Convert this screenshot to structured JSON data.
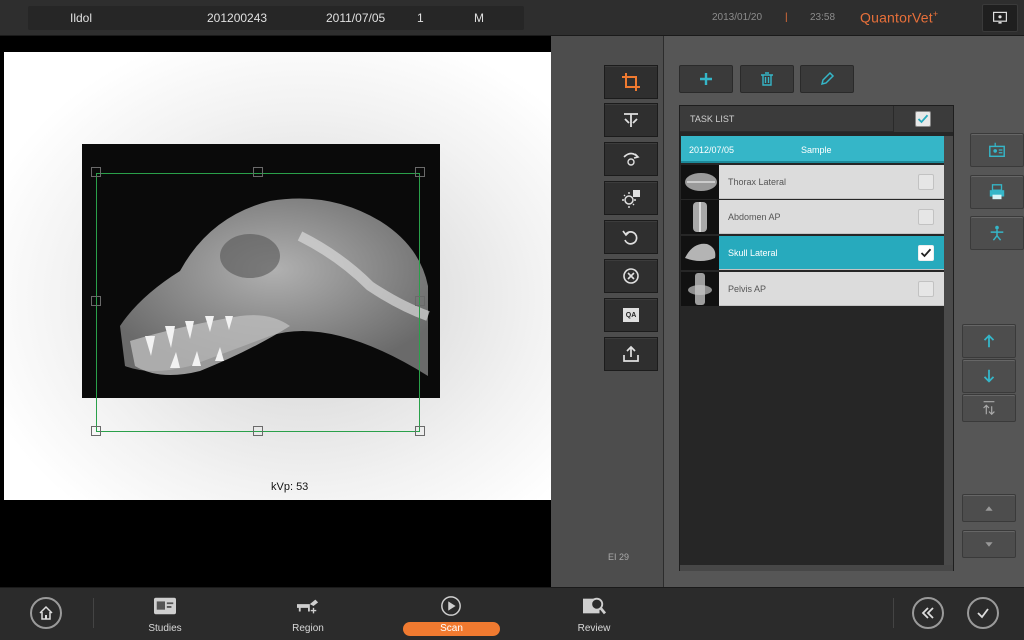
{
  "header": {
    "patient_name": "Ildol",
    "patient_id": "201200243",
    "birth_date": "2011/07/05",
    "patient_no": "1",
    "sex": "M",
    "current_date": "2013/01/20",
    "separator": "|",
    "current_time": "23:58",
    "brand": "QuantorVet",
    "brand_mark": "+"
  },
  "viewer": {
    "kvp_label": "kVp: 53",
    "ei_label": "EI  29"
  },
  "tools": [
    {
      "icon": "crop-icon",
      "active": true
    },
    {
      "icon": "flip-icon"
    },
    {
      "icon": "rotate-arrows-icon"
    },
    {
      "icon": "brightness-icon"
    },
    {
      "icon": "rotate-left-icon"
    },
    {
      "icon": "reject-icon"
    },
    {
      "icon": "qa-icon",
      "label": "QA"
    },
    {
      "icon": "export-icon"
    }
  ],
  "task_list": {
    "title": "TASK LIST",
    "study_date": "2012/07/05",
    "study_name": "Sample",
    "tasks": [
      {
        "label": "Thorax Lateral",
        "checked": false,
        "selected": false
      },
      {
        "label": "Abdomen AP",
        "checked": false,
        "selected": false
      },
      {
        "label": "Skull Lateral",
        "checked": true,
        "selected": true
      },
      {
        "label": "Pelvis AP",
        "checked": false,
        "selected": false
      }
    ]
  },
  "bottom_nav": {
    "studies": "Studies",
    "region": "Region",
    "scan": "Scan",
    "review": "Review"
  },
  "colors": {
    "accent": "#35b6c8",
    "scan_active": "#f07a30",
    "brand": "#e8703a",
    "crop_box": "#2aa04a"
  }
}
